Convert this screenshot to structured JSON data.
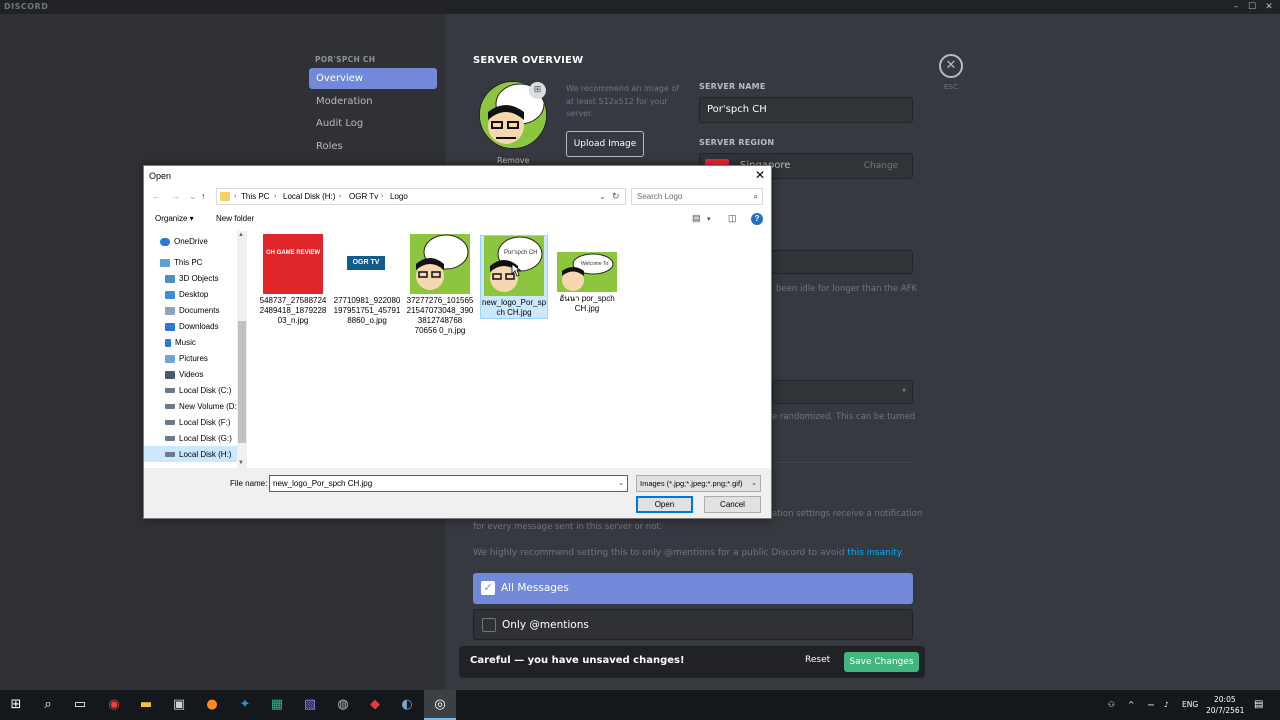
{
  "app": {
    "brand": "DISCORD"
  },
  "window_controls": {
    "minimize": "–",
    "maximize": "☐",
    "close": "✕"
  },
  "sidebar": {
    "header": "POR'SPCH CH",
    "items": [
      {
        "label": "Overview",
        "active": true
      },
      {
        "label": "Moderation",
        "active": false
      },
      {
        "label": "Audit Log",
        "active": false
      },
      {
        "label": "Roles",
        "active": false
      }
    ]
  },
  "overview": {
    "title": "SERVER OVERVIEW",
    "avatar_remove": "Remove",
    "image_hint": "We recommend an image of at least 512x512 for your server.",
    "upload_label": "Upload Image",
    "server_name_label": "SERVER NAME",
    "server_name_value": "Por'spch CH",
    "server_region_label": "SERVER REGION",
    "server_region_value": "Singapore",
    "region_change": "Change",
    "afk_partial": "been idle for longer than the AFK",
    "randomized_partial": "e randomized. This can be turned",
    "notif_partial": "ation settings receive a notification",
    "notif_line2": "for every message sent in this server or not.",
    "recommend_text": "We highly recommend setting this to only @mentions for a public Discord to avoid ",
    "recommend_link": "this insanity",
    "recommend_end": ".",
    "option_all": "All Messages",
    "option_mentions": "Only @mentions"
  },
  "close": {
    "symbol": "✕",
    "label": "ESC"
  },
  "unsaved_bar": {
    "text": "Careful — you have unsaved changes!",
    "reset": "Reset",
    "save": "Save Changes"
  },
  "dialog": {
    "title": "Open",
    "close": "✕",
    "breadcrumb": [
      "This PC",
      "Local Disk (H:)",
      "OGR Tv",
      "Logo"
    ],
    "search_placeholder": "Search Logo",
    "organize": "Organize ▾",
    "new_folder": "New folder",
    "nav_items": [
      {
        "label": "OneDrive",
        "color": "#2a7ad5"
      },
      {
        "label": "This PC",
        "color": "#5aa0d8"
      },
      {
        "label": "3D Objects",
        "color": "#4a90c8"
      },
      {
        "label": "Desktop",
        "color": "#3b8ed8"
      },
      {
        "label": "Documents",
        "color": "#8aa4c0"
      },
      {
        "label": "Downloads",
        "color": "#2a7ad5"
      },
      {
        "label": "Music",
        "color": "#2a7ad5"
      },
      {
        "label": "Pictures",
        "color": "#6fa5d8"
      },
      {
        "label": "Videos",
        "color": "#4a5a70"
      },
      {
        "label": "Local Disk (C:)",
        "color": "#6c7a89"
      },
      {
        "label": "New Volume (D:",
        "color": "#6c7a89"
      },
      {
        "label": "Local Disk (F:)",
        "color": "#6c7a89"
      },
      {
        "label": "Local Disk (G:)",
        "color": "#6c7a89"
      },
      {
        "label": "Local Disk (H:)",
        "color": "#6c7a89"
      }
    ],
    "files": [
      {
        "name": "548737_27588724 2489418_1879228 03_n.jpg",
        "thumb": "OH GAME REVIEW",
        "selected": false
      },
      {
        "name": "27710981_922080 197951751_45791 8860_o.jpg",
        "thumb": "OGR TV",
        "selected": false
      },
      {
        "name": "37277276_101565 21547073048_390 3812748768 70656 0_n.jpg",
        "thumb": "",
        "selected": false
      },
      {
        "name": "new_logo_Por_sp ch CH.jpg",
        "thumb": "Por'spch CH",
        "selected": true
      },
      {
        "name": "อันนา por_spch CH.jpg",
        "thumb": "Welcome To",
        "selected": false
      }
    ],
    "file_name_label": "File name:",
    "file_name_value": "new_logo_Por_spch CH.jpg",
    "file_type": "Images (*.jpg;*.jpeg;*.png;*.gif)",
    "open_btn": "Open",
    "cancel_btn": "Cancel"
  },
  "taskbar": {
    "lang": "ENG",
    "time": "20:05",
    "date": "20/7/2561"
  }
}
